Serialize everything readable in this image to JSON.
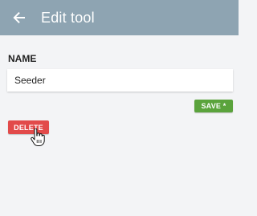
{
  "header": {
    "back_icon": "arrow-left-icon",
    "title": "Edit tool",
    "background_color": "#8ea4b2"
  },
  "form": {
    "name_label": "NAME",
    "name_value": "Seeder"
  },
  "actions": {
    "save_label": "SAVE *",
    "save_color": "#5aa33c",
    "delete_label": "DELETE",
    "delete_color": "#e24a4a"
  },
  "cursor": {
    "icon": "hand-pointer-icon"
  }
}
